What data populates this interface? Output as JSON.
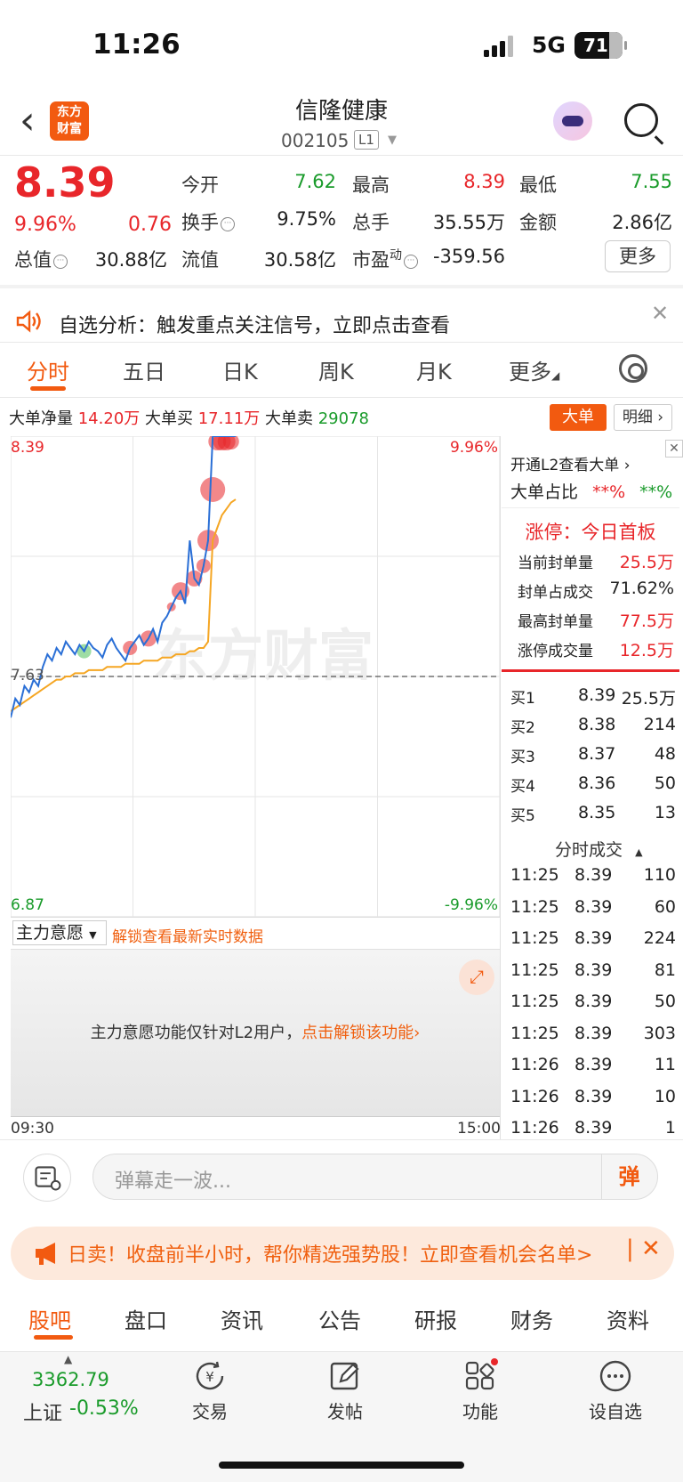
{
  "status": {
    "time": "11:26",
    "network": "5G",
    "battery": "71"
  },
  "nav": {
    "logo_text_1": "东方",
    "logo_text_2": "财富",
    "stock_name": "信隆健康",
    "stock_code": "002105",
    "level_badge": "L1"
  },
  "quote": {
    "price": "8.39",
    "change_pct": "9.96%",
    "change": "0.76",
    "fields": [
      {
        "label": "今开",
        "value": "7.62",
        "color": "#1a9b2b"
      },
      {
        "label": "最高",
        "value": "8.39",
        "color": "#e8262a"
      },
      {
        "label": "最低",
        "value": "7.55",
        "color": "#1a9b2b"
      },
      {
        "label": "换手",
        "value": "9.75%",
        "color": "#222222"
      },
      {
        "label": "总手",
        "value": "35.55万",
        "color": "#222222"
      },
      {
        "label": "金额",
        "value": "2.86亿",
        "color": "#222222"
      },
      {
        "label": "总值",
        "value": "30.88亿",
        "color": "#222222"
      },
      {
        "label": "流值",
        "value": "30.58亿",
        "color": "#222222"
      },
      {
        "label": "市盈",
        "value": "-359.56",
        "color": "#222222"
      }
    ],
    "pe_superscript": "动",
    "more_label": "更多"
  },
  "notice": {
    "text": "自选分析：触发重点关注信号，立即点击查看"
  },
  "chart_tabs": [
    "分时",
    "五日",
    "日K",
    "周K",
    "月K",
    "更多"
  ],
  "big_orders": {
    "net_label": "大单净量",
    "net_value": "14.20万",
    "buy_label": "大单买",
    "buy_value": "17.11万",
    "sell_label": "大单卖",
    "sell_value": "29078",
    "btn_big": "大单",
    "btn_detail": "明细"
  },
  "chart_data": {
    "type": "line",
    "y_top_label": "8.39",
    "y_bottom_label": "6.87",
    "y_top_pct": "9.96%",
    "y_bottom_pct": "-9.96%",
    "prev_close_label": "7.63",
    "x_start": "09:30",
    "x_end": "15:00",
    "ylim": [
      6.87,
      8.39
    ],
    "prev_close": 7.63,
    "watermark": "东方财富",
    "series": [
      {
        "values": [
          7.5,
          7.56,
          7.54,
          7.6,
          7.58,
          7.62,
          7.6,
          7.66,
          7.7,
          7.68,
          7.72,
          7.7,
          7.74,
          7.72,
          7.7,
          7.73,
          7.71,
          7.74,
          7.72,
          7.71,
          7.69,
          7.73,
          7.75,
          7.72,
          7.7,
          7.68,
          7.72,
          7.74,
          7.76,
          7.73,
          7.75,
          7.78,
          7.74,
          7.8,
          7.82,
          7.85,
          7.88,
          7.9,
          7.86,
          8.06,
          7.94,
          7.92,
          7.98,
          8.06,
          8.39,
          8.39,
          8.39,
          8.39,
          8.39,
          8.39
        ]
      },
      {
        "values": [
          7.52,
          7.53,
          7.54,
          7.55,
          7.56,
          7.57,
          7.58,
          7.59,
          7.6,
          7.61,
          7.62,
          7.62,
          7.63,
          7.63,
          7.64,
          7.64,
          7.64,
          7.65,
          7.65,
          7.65,
          7.65,
          7.66,
          7.66,
          7.66,
          7.66,
          7.67,
          7.67,
          7.67,
          7.67,
          7.68,
          7.68,
          7.68,
          7.68,
          7.69,
          7.69,
          7.69,
          7.7,
          7.7,
          7.7,
          7.71,
          7.71,
          7.72,
          7.72,
          7.74,
          8.06,
          8.1,
          8.14,
          8.16,
          8.18,
          8.19
        ]
      }
    ]
  },
  "side": {
    "l2_link": "开通L2查看大单",
    "ratio_label": "大单占比",
    "ratio_buy": "**%",
    "ratio_sell": "**%",
    "limit_title": "涨停：今日首板",
    "limit_rows": [
      {
        "label": "当前封单量",
        "value": "25.5万",
        "color": "#e8262a"
      },
      {
        "label": "封单占成交",
        "value": "71.62%",
        "color": "#222222"
      },
      {
        "label": "最高封单量",
        "value": "77.5万",
        "color": "#e8262a"
      },
      {
        "label": "涨停成交量",
        "value": "12.5万",
        "color": "#e8262a"
      }
    ],
    "bids": [
      {
        "label": "买1",
        "price": "8.39",
        "vol": "25.5万"
      },
      {
        "label": "买2",
        "price": "8.38",
        "vol": "214"
      },
      {
        "label": "买3",
        "price": "8.37",
        "vol": "48"
      },
      {
        "label": "买4",
        "price": "8.36",
        "vol": "50"
      },
      {
        "label": "买5",
        "price": "8.35",
        "vol": "13"
      }
    ],
    "ticks_title": "分时成交",
    "ticks": [
      {
        "time": "11:25",
        "price": "8.39",
        "vol": "110"
      },
      {
        "time": "11:25",
        "price": "8.39",
        "vol": "60"
      },
      {
        "time": "11:25",
        "price": "8.39",
        "vol": "224"
      },
      {
        "time": "11:25",
        "price": "8.39",
        "vol": "81"
      },
      {
        "time": "11:25",
        "price": "8.39",
        "vol": "50"
      },
      {
        "time": "11:25",
        "price": "8.39",
        "vol": "303"
      },
      {
        "time": "11:26",
        "price": "8.39",
        "vol": "11"
      },
      {
        "time": "11:26",
        "price": "8.39",
        "vol": "10"
      },
      {
        "time": "11:26",
        "price": "8.39",
        "vol": "1"
      }
    ]
  },
  "wish": {
    "dropdown": "主力意愿",
    "unlock_hint": "解锁查看最新实时数据",
    "locked_text": "主力意愿功能仅针对L2用户，",
    "locked_link": "点击解锁该功能"
  },
  "danmu": {
    "placeholder": "弹幕走一波...",
    "button": "弹"
  },
  "banner": {
    "text": "日卖！收盘前半小时，帮你精选强势股！立即查看机会名单>"
  },
  "bottom_tabs": [
    "股吧",
    "盘口",
    "资讯",
    "公告",
    "研报",
    "财务",
    "资料"
  ],
  "footer": {
    "index_value": "3362.79",
    "index_name": "上证",
    "index_change": "-0.53%",
    "items": [
      "交易",
      "发帖",
      "功能",
      "设自选"
    ]
  }
}
